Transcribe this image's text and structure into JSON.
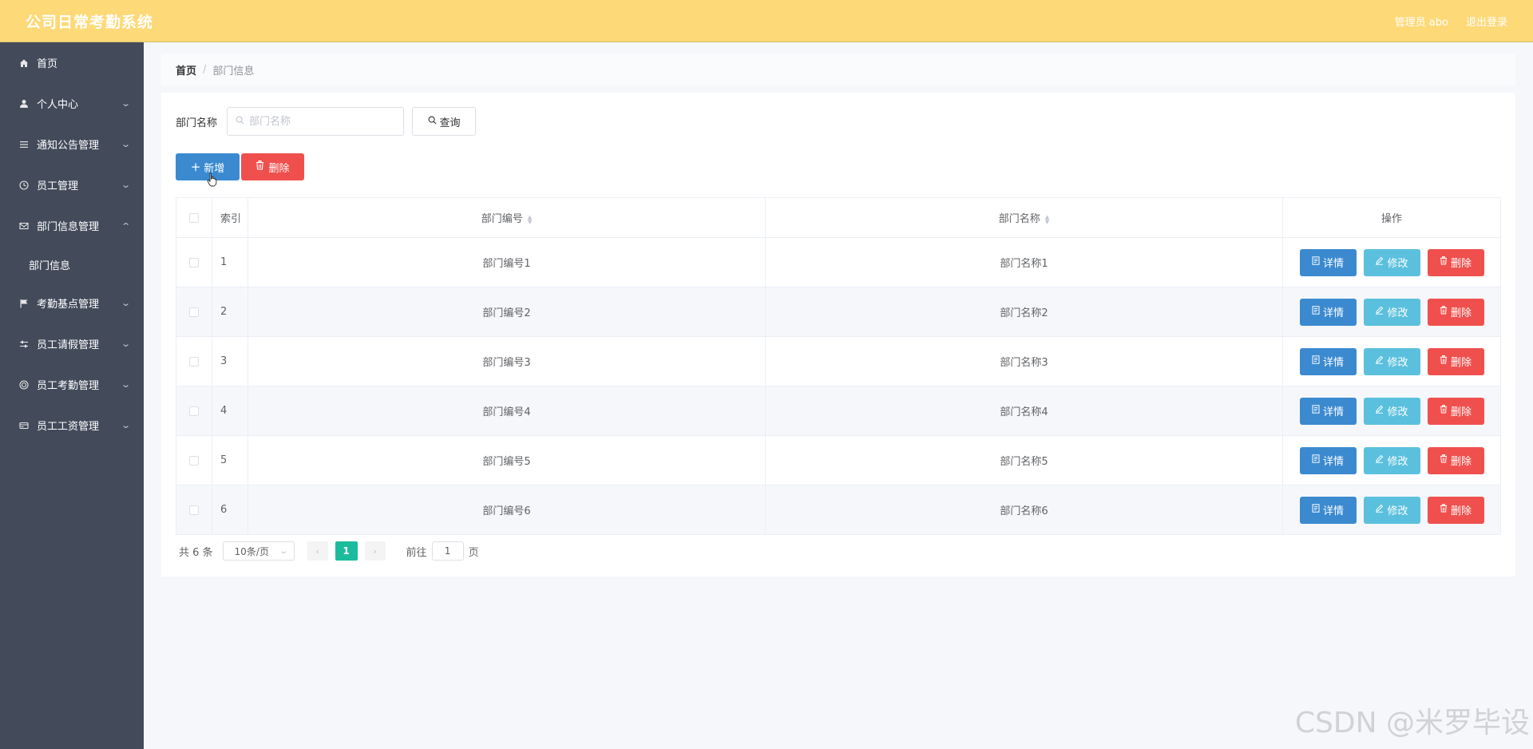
{
  "app": {
    "title": "公司日常考勤系统",
    "admin_label": "管理员 abo",
    "logout_label": "退出登录"
  },
  "colors": {
    "header_bg": "#fed978",
    "sidebar_bg": "#434b5b",
    "primary": "#3b8ad0",
    "info": "#5bc0de",
    "danger": "#f0504d",
    "pager_active": "#1abc9c"
  },
  "sidebar": {
    "items": [
      {
        "label": "首页",
        "icon": "home-icon"
      },
      {
        "label": "个人中心",
        "icon": "user-icon"
      },
      {
        "label": "通知公告管理",
        "icon": "list-icon"
      },
      {
        "label": "员工管理",
        "icon": "clock-icon"
      },
      {
        "label": "部门信息管理",
        "icon": "mail-icon"
      },
      {
        "label": "考勤基点管理",
        "icon": "flag-icon"
      },
      {
        "label": "员工请假管理",
        "icon": "sliders-icon"
      },
      {
        "label": "员工考勤管理",
        "icon": "target-icon"
      },
      {
        "label": "员工工资管理",
        "icon": "card-icon"
      }
    ],
    "sub_item": "部门信息"
  },
  "breadcrumb": {
    "home": "首页",
    "separator": "/",
    "current": "部门信息"
  },
  "search": {
    "label": "部门名称",
    "placeholder": "部门名称",
    "button": "查询"
  },
  "actions": {
    "add": "新增",
    "delete": "删除"
  },
  "table": {
    "headers": {
      "index": "索引",
      "code": "部门编号",
      "name": "部门名称",
      "ops": "操作"
    },
    "op_labels": {
      "detail": "详情",
      "edit": "修改",
      "remove": "删除"
    },
    "rows": [
      {
        "index": "1",
        "code": "部门编号1",
        "name": "部门名称1"
      },
      {
        "index": "2",
        "code": "部门编号2",
        "name": "部门名称2"
      },
      {
        "index": "3",
        "code": "部门编号3",
        "name": "部门名称3"
      },
      {
        "index": "4",
        "code": "部门编号4",
        "name": "部门名称4"
      },
      {
        "index": "5",
        "code": "部门编号5",
        "name": "部门名称5"
      },
      {
        "index": "6",
        "code": "部门编号6",
        "name": "部门名称6"
      }
    ]
  },
  "pager": {
    "total": "共 6 条",
    "page_size": "10条/页",
    "current": "1",
    "goto_label": "前往",
    "goto_value": "1",
    "page_suffix": "页"
  },
  "watermark": "CSDN @米罗毕设"
}
